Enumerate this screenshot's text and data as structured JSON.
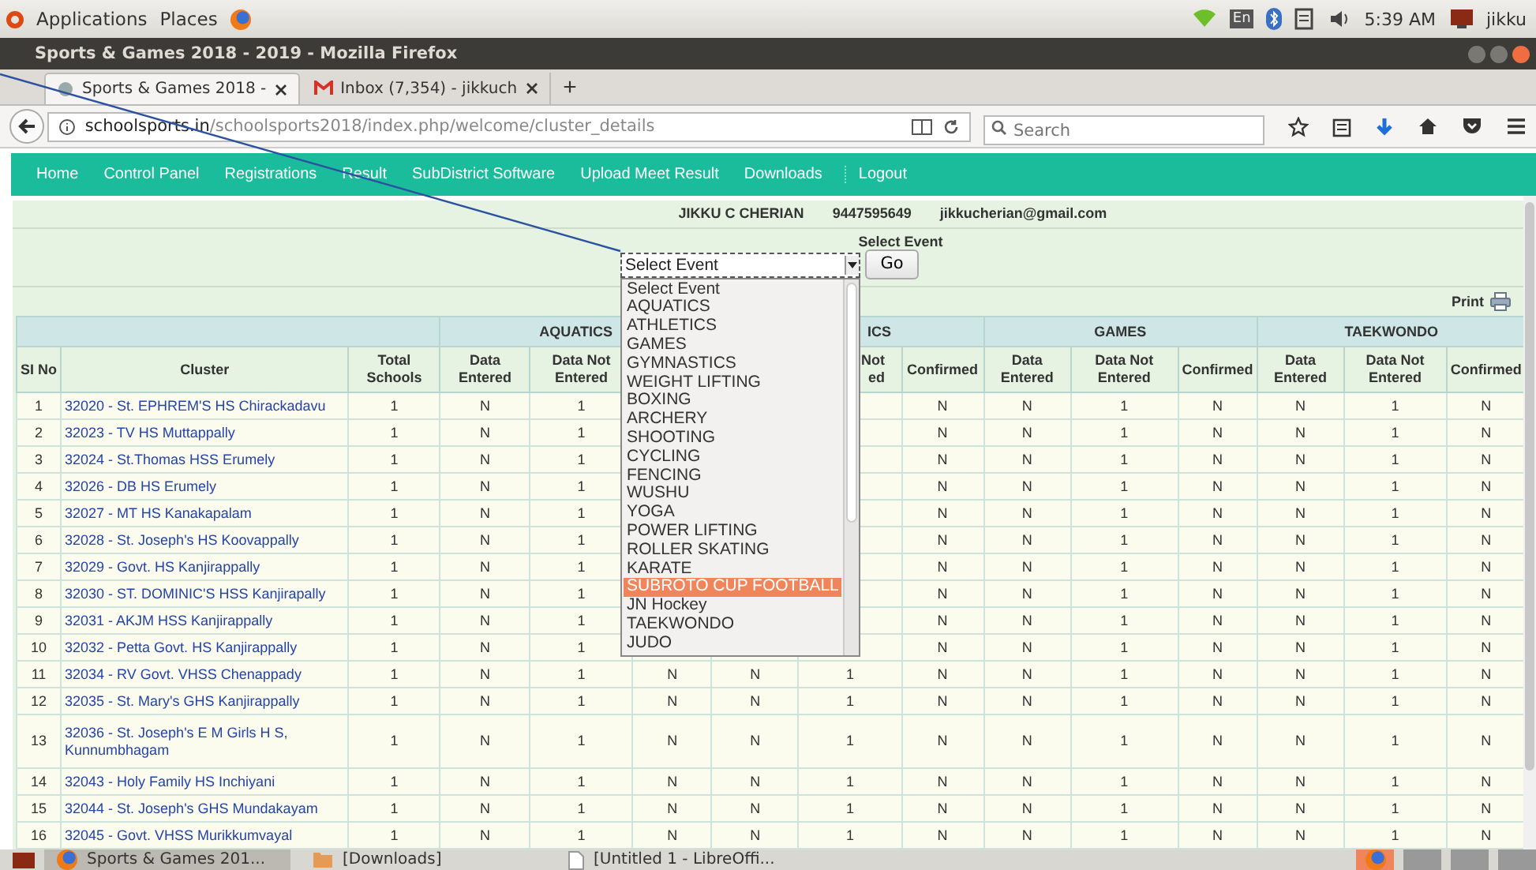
{
  "top_panel": {
    "menus": [
      "Applications",
      "Places"
    ],
    "keyboard": "En",
    "clock": "5:39 AM",
    "user": "jikku"
  },
  "window": {
    "title": "Sports & Games 2018 - 2019 - Mozilla Firefox"
  },
  "tabs": [
    {
      "label": "Sports & Games 2018 -",
      "selected": true
    },
    {
      "label": "Inbox (7,354) - jikkuch",
      "selected": false
    }
  ],
  "new_tab": "+",
  "address": {
    "host": "schoolsports.in",
    "path": "/schoolsports2018/index.php/welcome/cluster_details"
  },
  "search": {
    "placeholder": "Search"
  },
  "menu": [
    "Home",
    "Control Panel",
    "Registrations",
    "Result",
    "SubDistrict Software",
    "Upload Meet Result",
    "Downloads",
    "Logout"
  ],
  "user_info": {
    "name": "JIKKU C CHERIAN",
    "phone": "9447595649",
    "email": "jikkucherian@gmail.com"
  },
  "event_select": {
    "label": "Select Event",
    "value": "Select Event",
    "button": "Go",
    "expanded": true,
    "options": [
      {
        "label": "Select Event",
        "highlighted": false
      },
      {
        "label": "AQUATICS",
        "highlighted": false
      },
      {
        "label": "ATHLETICS",
        "highlighted": false
      },
      {
        "label": "GAMES",
        "highlighted": false
      },
      {
        "label": "GYMNASTICS",
        "highlighted": false
      },
      {
        "label": "WEIGHT LIFTING",
        "highlighted": false
      },
      {
        "label": "BOXING",
        "highlighted": false
      },
      {
        "label": "ARCHERY",
        "highlighted": false
      },
      {
        "label": "SHOOTING",
        "highlighted": false
      },
      {
        "label": "CYCLING",
        "highlighted": false
      },
      {
        "label": "FENCING",
        "highlighted": false
      },
      {
        "label": "WUSHU",
        "highlighted": false
      },
      {
        "label": "YOGA",
        "highlighted": false
      },
      {
        "label": "POWER LIFTING",
        "highlighted": false
      },
      {
        "label": "ROLLER SKATING",
        "highlighted": false
      },
      {
        "label": "KARATE",
        "highlighted": false
      },
      {
        "label": "SUBROTO CUP FOOTBALL",
        "highlighted": true
      },
      {
        "label": "JN Hockey",
        "highlighted": false
      },
      {
        "label": "TAEKWONDO",
        "highlighted": false
      },
      {
        "label": "JUDO",
        "highlighted": false
      }
    ]
  },
  "print": "Print",
  "table": {
    "groups": [
      "AQUATICS",
      "ICS",
      "GAMES",
      "TAEKWONDO"
    ],
    "columns": [
      "SI No",
      "Cluster",
      "Total\nSchools",
      "Data\nEntered",
      "Data Not\nEntered",
      null,
      null,
      "Not\ned",
      "Confirmed",
      "Data\nEntered",
      "Data Not\nEntered",
      "Confirmed",
      "Data\nEntered",
      "Data Not\nEntered",
      "Confirmed"
    ],
    "rows": [
      {
        "cells": [
          "1",
          "32020 -  St. EPHREM'S HS Chirackadavu",
          "1",
          "N",
          "1",
          null,
          null,
          null,
          "N",
          "N",
          "1",
          "N",
          "N",
          "1",
          "N"
        ]
      },
      {
        "cells": [
          "2",
          "32023 -  TV HS Muttappally",
          "1",
          "N",
          "1",
          null,
          null,
          null,
          "N",
          "N",
          "1",
          "N",
          "N",
          "1",
          "N"
        ]
      },
      {
        "cells": [
          "3",
          "32024 -  St.Thomas HSS Erumely",
          "1",
          "N",
          "1",
          null,
          null,
          null,
          "N",
          "N",
          "1",
          "N",
          "N",
          "1",
          "N"
        ]
      },
      {
        "cells": [
          "4",
          "32026 -  DB HS Erumely",
          "1",
          "N",
          "1",
          null,
          null,
          null,
          "N",
          "N",
          "1",
          "N",
          "N",
          "1",
          "N"
        ]
      },
      {
        "cells": [
          "5",
          "32027 -  MT HS Kanakapalam",
          "1",
          "N",
          "1",
          null,
          null,
          null,
          "N",
          "N",
          "1",
          "N",
          "N",
          "1",
          "N"
        ]
      },
      {
        "cells": [
          "6",
          "32028 -  St. Joseph's HS Koovappally",
          "1",
          "N",
          "1",
          null,
          null,
          null,
          "N",
          "N",
          "1",
          "N",
          "N",
          "1",
          "N"
        ]
      },
      {
        "cells": [
          "7",
          "32029 -  Govt. HS Kanjirappally",
          "1",
          "N",
          "1",
          null,
          null,
          null,
          "N",
          "N",
          "1",
          "N",
          "N",
          "1",
          "N"
        ]
      },
      {
        "cells": [
          "8",
          "32030 -  ST. DOMINIC'S HSS Kanjirapally",
          "1",
          "N",
          "1",
          null,
          null,
          null,
          "N",
          "N",
          "1",
          "N",
          "N",
          "1",
          "N"
        ]
      },
      {
        "cells": [
          "9",
          "32031 -  AKJM HSS Kanjirappally",
          "1",
          "N",
          "1",
          null,
          null,
          null,
          "N",
          "N",
          "1",
          "N",
          "N",
          "1",
          "N"
        ]
      },
      {
        "cells": [
          "10",
          "32032 -  Petta Govt. HS Kanjirappally",
          "1",
          "N",
          "1",
          null,
          null,
          null,
          "N",
          "N",
          "1",
          "N",
          "N",
          "1",
          "N"
        ]
      },
      {
        "cells": [
          "11",
          "32034 -  RV Govt. VHSS Chenappady",
          "1",
          "N",
          "1",
          "N",
          "N",
          "1",
          "N",
          "N",
          "1",
          "N",
          "N",
          "1",
          "N"
        ]
      },
      {
        "cells": [
          "12",
          "32035 -  St. Mary's GHS Kanjirappally",
          "1",
          "N",
          "1",
          "N",
          "N",
          "1",
          "N",
          "N",
          "1",
          "N",
          "N",
          "1",
          "N"
        ]
      },
      {
        "cells": [
          "13",
          "32036 -  St. Joseph's E M Girls H S, Kunnumbhagam",
          "1",
          "N",
          "1",
          "N",
          "N",
          "1",
          "N",
          "N",
          "1",
          "N",
          "N",
          "1",
          "N"
        ]
      },
      {
        "cells": [
          "14",
          "32043 -  Holy Family HS Inchiyani",
          "1",
          "N",
          "1",
          "N",
          "N",
          "1",
          "N",
          "N",
          "1",
          "N",
          "N",
          "1",
          "N"
        ]
      },
      {
        "cells": [
          "15",
          "32044 -  St. Joseph's GHS Mundakayam",
          "1",
          "N",
          "1",
          "N",
          "N",
          "1",
          "N",
          "N",
          "1",
          "N",
          "N",
          "1",
          "N"
        ]
      },
      {
        "cells": [
          "16",
          "32045 -  Govt. VHSS Murikkumvayal",
          "1",
          "N",
          "1",
          "N",
          "N",
          "1",
          "N",
          "N",
          "1",
          "N",
          "N",
          "1",
          "N"
        ]
      }
    ]
  },
  "taskbar": [
    {
      "kind": "browser",
      "label": "Sports & Games 201...",
      "selected": true
    },
    {
      "kind": "folder",
      "label": "[Downloads]",
      "selected": false
    },
    {
      "kind": "document",
      "label": "[Untitled 1 - LibreOffi...",
      "selected": false
    }
  ]
}
